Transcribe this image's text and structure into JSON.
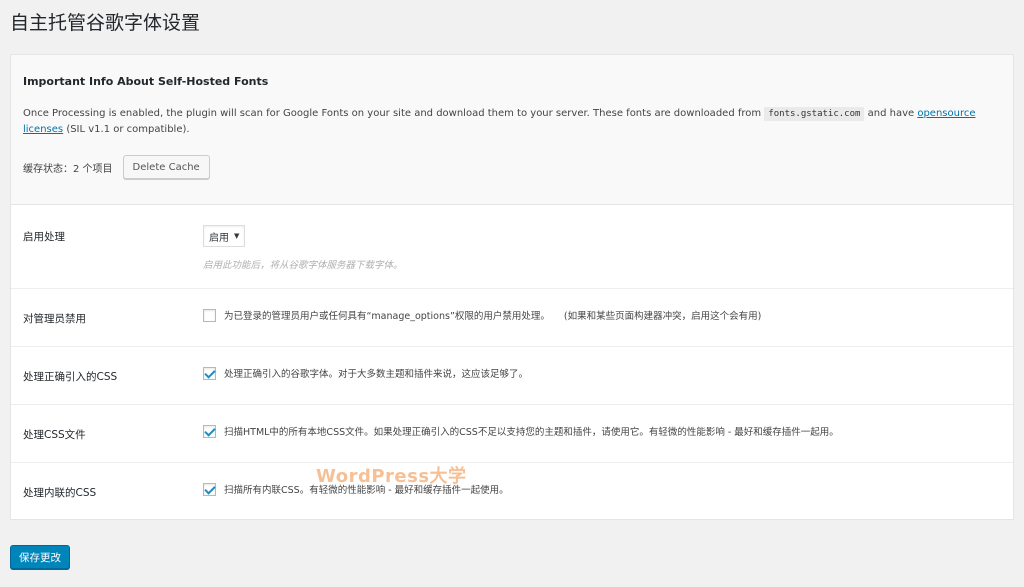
{
  "page": {
    "title": "自主托管谷歌字体设置"
  },
  "info": {
    "title": "Important Info About Self-Hosted Fonts",
    "text_before_code": "Once Processing is enabled, the plugin will scan for Google Fonts on your site and download them to your server. These fonts are downloaded from",
    "code": "fonts.gstatic.com",
    "text_after_code": "and have",
    "link": "opensource licenses",
    "text_end": "(SIL v1.1 or compatible).",
    "cache_status": "缓存状态：2 个项目",
    "cache_button": "Delete Cache"
  },
  "settings": {
    "enable": {
      "label": "启用处理",
      "selected": "启用",
      "description": "启用此功能后，将从谷歌字体服务器下载字体。"
    },
    "disable_admin": {
      "label": "对管理员禁用",
      "checked": false,
      "text": "为已登录的管理员用户或任何具有“manage_options”权限的用户禁用处理。",
      "note": "(如果和某些页面构建器冲突，启用这个会有用)"
    },
    "process_enqueued": {
      "label": "处理正确引入的CSS",
      "checked": true,
      "text": "处理正确引入的谷歌字体。对于大多数主题和插件来说，这应该足够了。"
    },
    "process_css_files": {
      "label": "处理CSS文件",
      "checked": true,
      "text": "扫描HTML中的所有本地CSS文件。如果处理正确引入的CSS不足以支持您的主题和插件，请使用它。有轻微的性能影响 - 最好和缓存插件一起用。"
    },
    "process_inline": {
      "label": "处理内联的CSS",
      "checked": true,
      "text": "扫描所有内联CSS。有轻微的性能影响 - 最好和缓存插件一起使用。"
    }
  },
  "watermark": "WordPress大学",
  "save_button": "保存更改",
  "colors": {
    "primary": "#0085ba",
    "checkmark": "#1e8cbe",
    "link": "#0073aa"
  }
}
